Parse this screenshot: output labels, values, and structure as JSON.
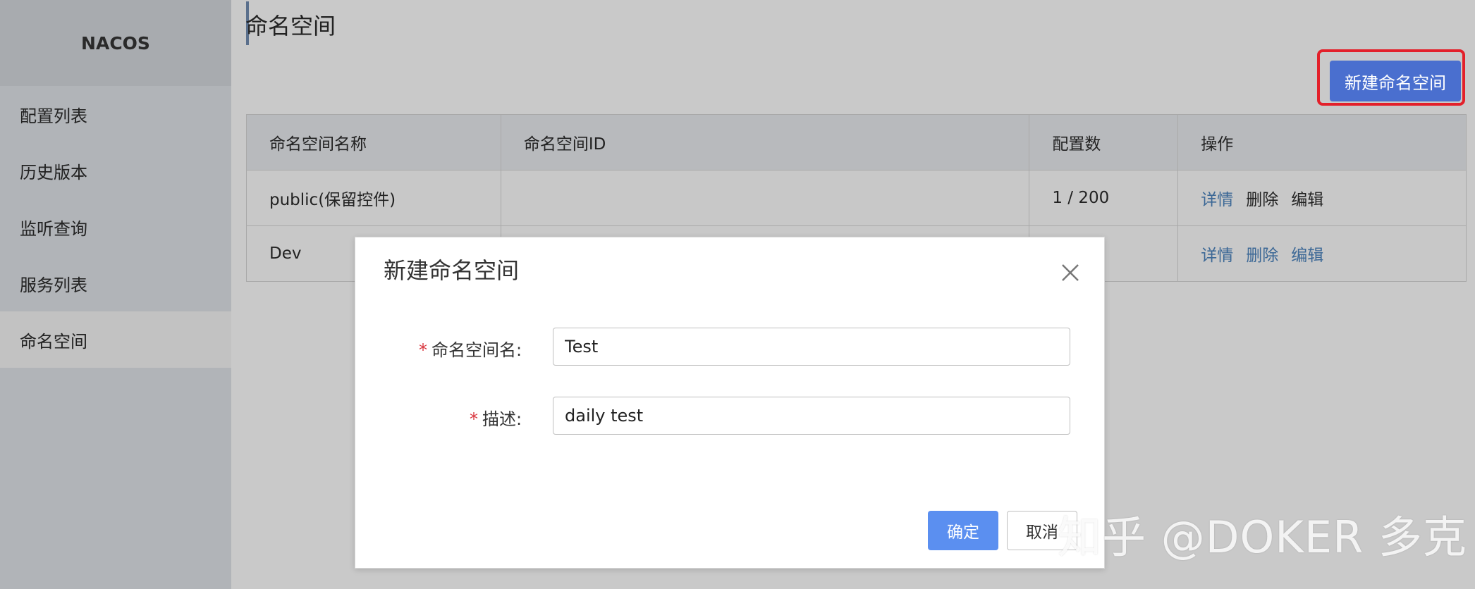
{
  "sidebar": {
    "logo": "NACOS",
    "items": [
      {
        "label": "配置列表"
      },
      {
        "label": "历史版本"
      },
      {
        "label": "监听查询"
      },
      {
        "label": "服务列表"
      },
      {
        "label": "命名空间"
      }
    ]
  },
  "page": {
    "title": "命名空间",
    "new_button": "新建命名空间"
  },
  "table": {
    "headers": [
      "命名空间名称",
      "命名空间ID",
      "配置数",
      "操作"
    ],
    "rows": [
      {
        "name": "public(保留控件)",
        "id": "",
        "count": "1 / 200",
        "actions": [
          "详情",
          "删除",
          "编辑"
        ]
      },
      {
        "name": "Dev",
        "id": "",
        "count": "",
        "actions": [
          "详情",
          "删除",
          "编辑"
        ]
      }
    ]
  },
  "dialog": {
    "title": "新建命名空间",
    "fields": [
      {
        "label": "命名空间名:",
        "value": "Test"
      },
      {
        "label": "描述:",
        "value": "daily test"
      }
    ],
    "required_mark": "*",
    "ok": "确定",
    "cancel": "取消"
  },
  "watermark": "知乎 @DOKER 多克",
  "colors": {
    "primary": "#4a6fcf",
    "link": "#3c6896",
    "highlight_border": "#e3202a",
    "required": "#d9363e"
  },
  "icons": {
    "close": "close-icon"
  }
}
